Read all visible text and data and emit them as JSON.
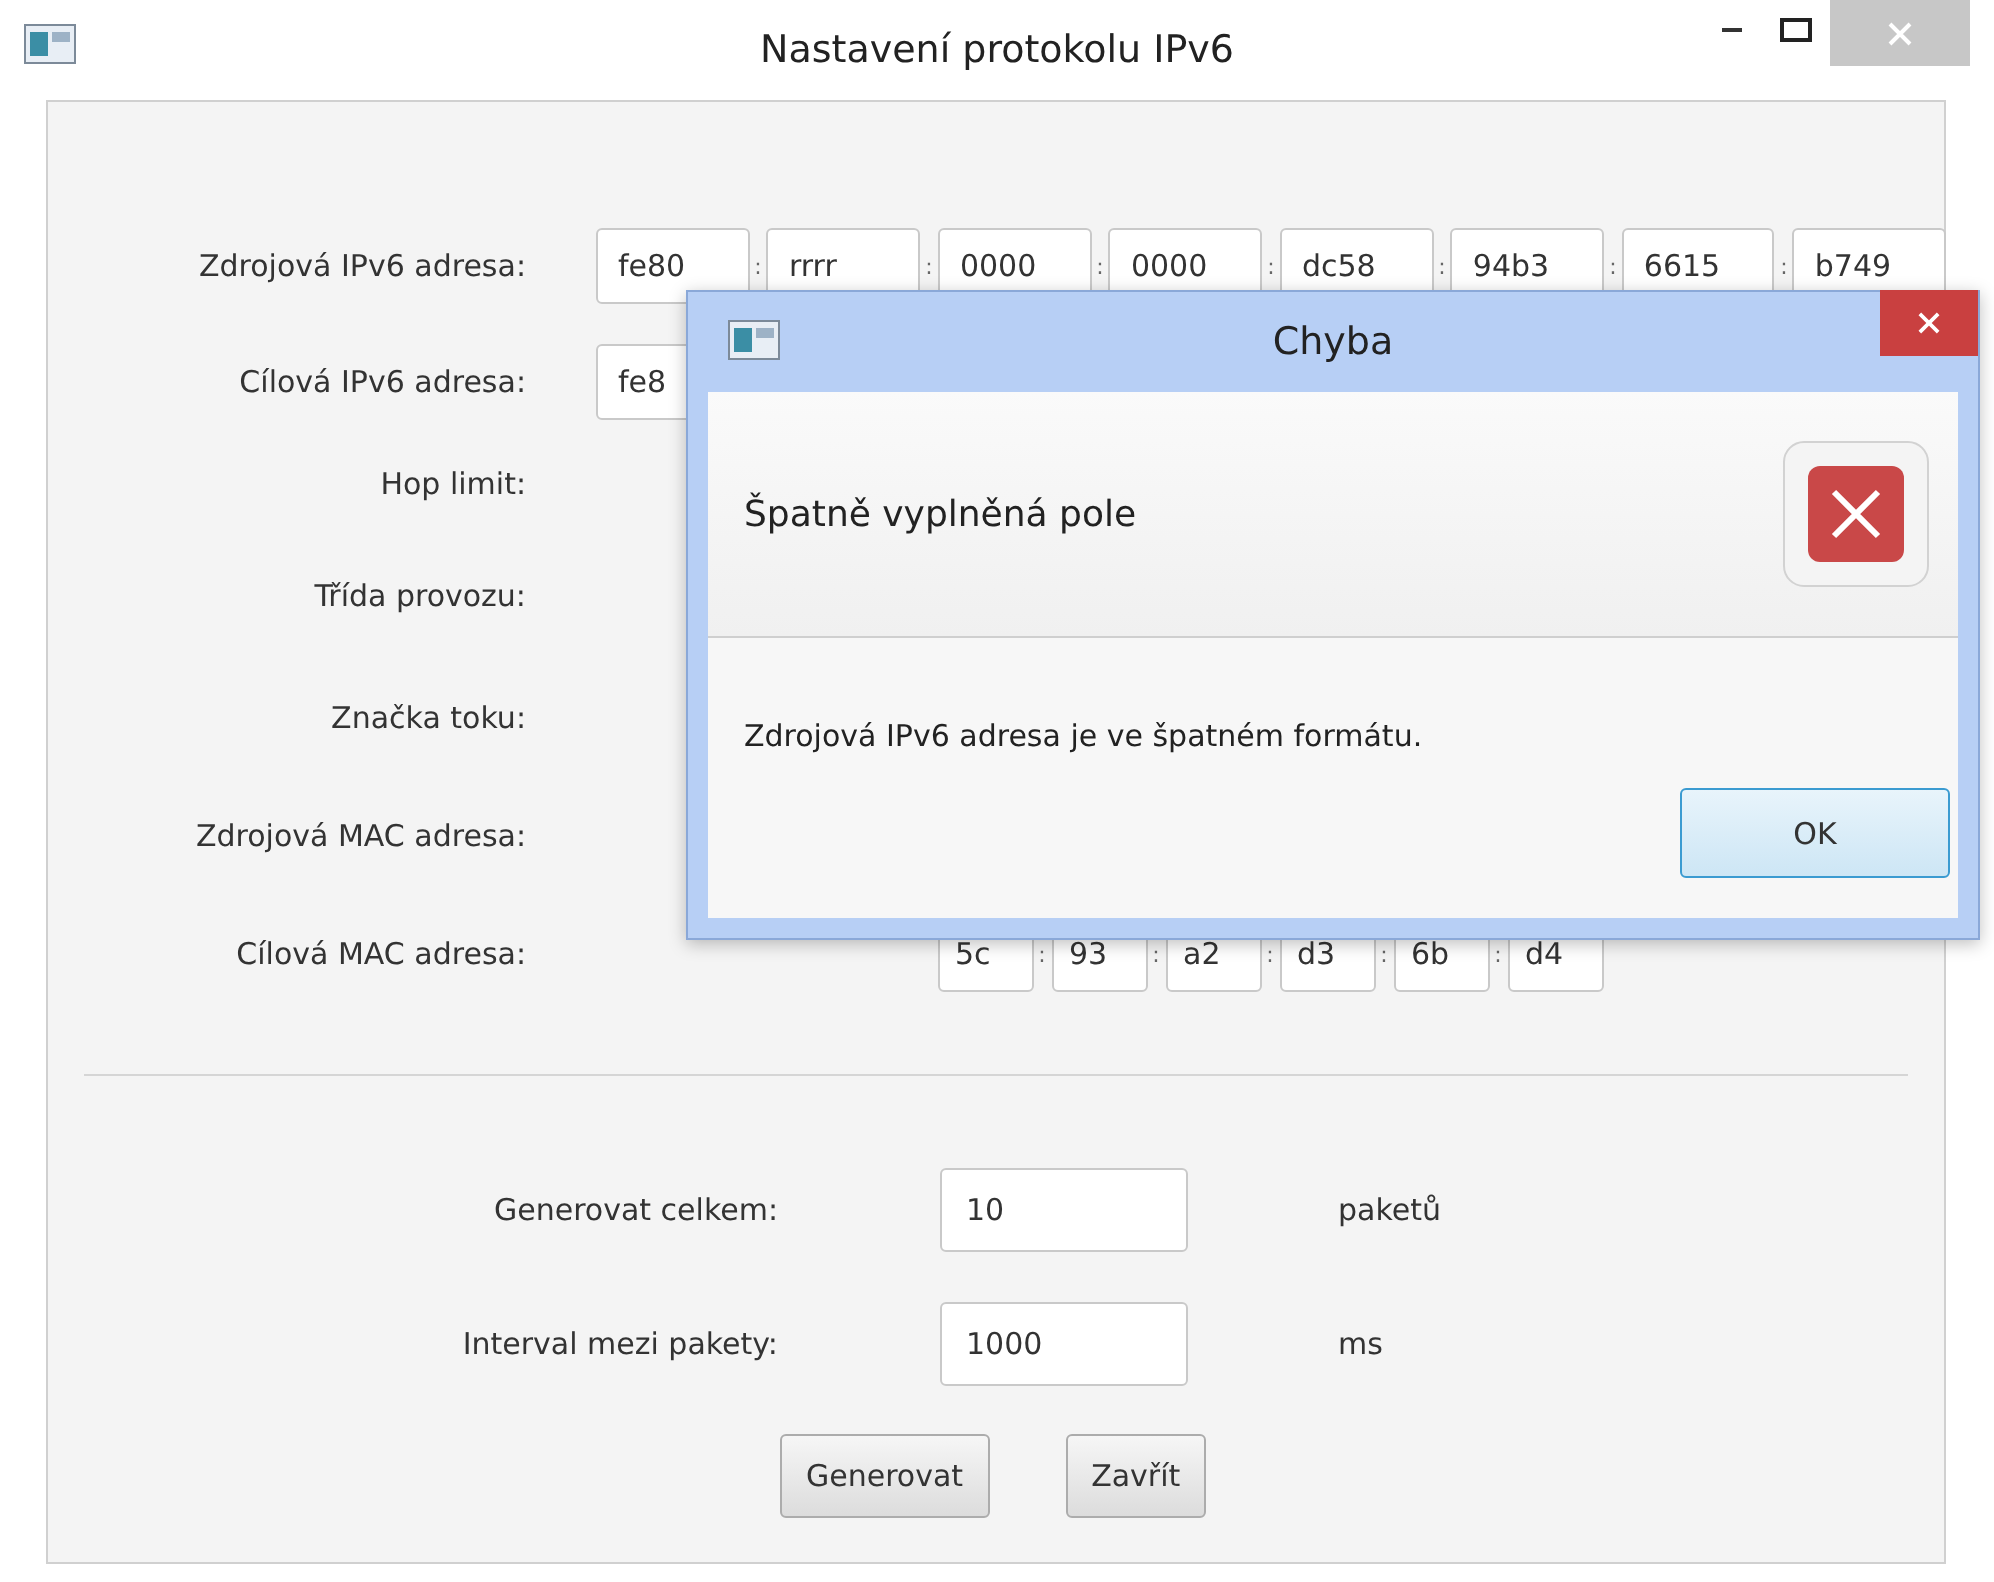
{
  "window": {
    "title": "Nastavení protokolu IPv6"
  },
  "address_rows": [
    {
      "label": "Zdrojová IPv6 adresa:",
      "kind": "ipv6",
      "separator": ":",
      "fields": [
        "fe80",
        "rrrr",
        "0000",
        "0000",
        "dc58",
        "94b3",
        "6615",
        "b749"
      ]
    },
    {
      "label": "Cílová IPv6 adresa:",
      "kind": "ipv6",
      "fields": [
        "fe8"
      ]
    },
    {
      "label": "Hop limit:",
      "kind": "none"
    },
    {
      "label": "Třída provozu:",
      "kind": "none"
    },
    {
      "label": "Značka toku:",
      "kind": "none"
    },
    {
      "label": "Zdrojová MAC adresa:",
      "kind": "none"
    },
    {
      "label": "Cílová MAC adresa:",
      "kind": "mac",
      "separator": ":",
      "fields": [
        "5c",
        "93",
        "a2",
        "d3",
        "6b",
        "d4"
      ]
    }
  ],
  "generation": [
    {
      "label": "Generovat celkem:",
      "value": "10",
      "unit": "paketů"
    },
    {
      "label": "Interval mezi pakety:",
      "value": "1000",
      "unit": "ms"
    }
  ],
  "buttons": [
    "Generovat",
    "Zavřít"
  ],
  "dialog": {
    "title": "Chyba",
    "header": "Špatně vyplněná pole",
    "message": "Zdrojová IPv6 adresa je ve špatném formátu.",
    "button": "OK"
  }
}
